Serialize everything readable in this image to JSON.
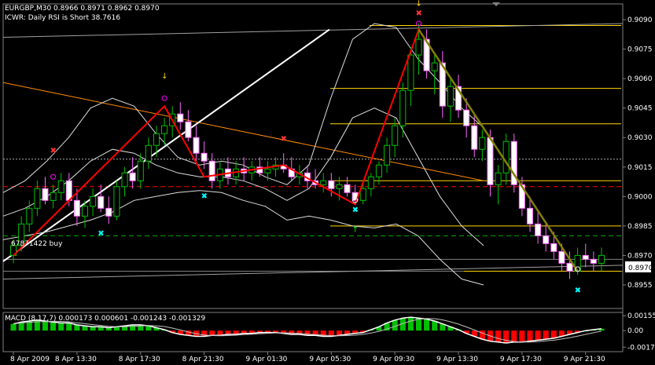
{
  "header": {
    "symbol_line": "EURGBP,M30  0.8966 0.8971 0.8962 0.8970",
    "indicator_line": "ICWR: Daily RSI is Short 38.7616"
  },
  "annotations": {
    "buy_label": "67871422 buy",
    "current_price": "0.8970"
  },
  "macd": {
    "label": "MACD (8,17,7) 0.000173 0.000601 -0.001243 -0.001329",
    "ticks": [
      "0.001556",
      "0.00",
      "-0.00173"
    ]
  },
  "chart_data": [
    {
      "type": "candlestick",
      "title": "EURGBP,M30",
      "ylim": [
        0.8943,
        0.9098
      ],
      "y_ticks": [
        "0.9090",
        "0.9075",
        "0.9060",
        "0.9045",
        "0.9030",
        "0.9015",
        "0.9000",
        "0.8985",
        "0.8970",
        "0.8955"
      ],
      "x_ticks": [
        "8 Apr 2009",
        "8 Apr 13:30",
        "8 Apr 17:30",
        "8 Apr 21:30",
        "9 Apr 01:30",
        "9 Apr 05:30",
        "9 Apr 09:30",
        "9 Apr 13:30",
        "9 Apr 17:30",
        "9 Apr 21:30"
      ],
      "candles": [
        [
          0.897,
          0.8978,
          0.8966,
          0.8975
        ],
        [
          0.8975,
          0.899,
          0.8972,
          0.8986
        ],
        [
          0.8986,
          0.8998,
          0.8982,
          0.8994
        ],
        [
          0.8994,
          0.9008,
          0.899,
          0.9004
        ],
        [
          0.9004,
          0.901,
          0.8996,
          0.8998
        ],
        [
          0.8998,
          0.9006,
          0.8994,
          0.9002
        ],
        [
          0.9002,
          0.9012,
          0.8998,
          0.9008
        ],
        [
          0.9008,
          0.9012,
          0.8995,
          0.8998
        ],
        [
          0.8998,
          0.9004,
          0.8985,
          0.899
        ],
        [
          0.899,
          0.8998,
          0.8984,
          0.8995
        ],
        [
          0.8995,
          0.9004,
          0.899,
          0.9
        ],
        [
          0.9,
          0.9006,
          0.8992,
          0.8994
        ],
        [
          0.8994,
          0.9,
          0.8986,
          0.899
        ],
        [
          0.899,
          0.9008,
          0.8988,
          0.9005
        ],
        [
          0.9005,
          0.9015,
          0.9,
          0.9012
        ],
        [
          0.9012,
          0.902,
          0.9004,
          0.9008
        ],
        [
          0.9008,
          0.9022,
          0.9004,
          0.9018
        ],
        [
          0.9018,
          0.903,
          0.9014,
          0.9026
        ],
        [
          0.9026,
          0.9036,
          0.902,
          0.9032
        ],
        [
          0.9032,
          0.904,
          0.9026,
          0.9036
        ],
        [
          0.9036,
          0.9046,
          0.903,
          0.9042
        ],
        [
          0.9042,
          0.9048,
          0.9034,
          0.9038
        ],
        [
          0.9038,
          0.9044,
          0.9028,
          0.903
        ],
        [
          0.903,
          0.9036,
          0.9018,
          0.9022
        ],
        [
          0.9022,
          0.9028,
          0.9014,
          0.9018
        ],
        [
          0.9018,
          0.9022,
          0.9004,
          0.9008
        ],
        [
          0.9008,
          0.9018,
          0.9004,
          0.9014
        ],
        [
          0.9014,
          0.902,
          0.9006,
          0.901
        ],
        [
          0.901,
          0.9018,
          0.9006,
          0.9014
        ],
        [
          0.9014,
          0.902,
          0.9008,
          0.9012
        ],
        [
          0.9012,
          0.9018,
          0.9008,
          0.9015
        ],
        [
          0.9015,
          0.902,
          0.901,
          0.9012
        ],
        [
          0.9012,
          0.9018,
          0.9008,
          0.9014
        ],
        [
          0.9014,
          0.902,
          0.901,
          0.9016
        ],
        [
          0.9016,
          0.9022,
          0.9012,
          0.9014
        ],
        [
          0.9014,
          0.902,
          0.9008,
          0.901
        ],
        [
          0.901,
          0.9016,
          0.9006,
          0.9012
        ],
        [
          0.9012,
          0.9016,
          0.9004,
          0.9008
        ],
        [
          0.9008,
          0.9014,
          0.9004,
          0.9006
        ],
        [
          0.9006,
          0.9012,
          0.9002,
          0.9008
        ],
        [
          0.9008,
          0.9012,
          0.9,
          0.9004
        ],
        [
          0.9004,
          0.901,
          0.8998,
          0.9006
        ],
        [
          0.9006,
          0.901,
          0.9,
          0.9002
        ],
        [
          0.9002,
          0.9006,
          0.8996,
          0.8998
        ],
        [
          0.8998,
          0.9006,
          0.8996,
          0.9004
        ],
        [
          0.9004,
          0.9012,
          0.9,
          0.901
        ],
        [
          0.901,
          0.9018,
          0.9006,
          0.9016
        ],
        [
          0.9016,
          0.903,
          0.9012,
          0.9026
        ],
        [
          0.9026,
          0.904,
          0.902,
          0.9036
        ],
        [
          0.9036,
          0.9058,
          0.903,
          0.9054
        ],
        [
          0.9054,
          0.9076,
          0.9046,
          0.9072
        ],
        [
          0.9072,
          0.9088,
          0.9062,
          0.908
        ],
        [
          0.908,
          0.9085,
          0.906,
          0.9064
        ],
        [
          0.9064,
          0.9072,
          0.9052,
          0.9068
        ],
        [
          0.9068,
          0.9074,
          0.904,
          0.9046
        ],
        [
          0.9046,
          0.906,
          0.9038,
          0.9056
        ],
        [
          0.9056,
          0.9062,
          0.904,
          0.9044
        ],
        [
          0.9044,
          0.905,
          0.903,
          0.9036
        ],
        [
          0.9036,
          0.9042,
          0.902,
          0.9024
        ],
        [
          0.9024,
          0.9034,
          0.9018,
          0.903
        ],
        [
          0.903,
          0.9034,
          0.9,
          0.9006
        ],
        [
          0.9006,
          0.9016,
          0.8996,
          0.9012
        ],
        [
          0.9012,
          0.9032,
          0.9006,
          0.9028
        ],
        [
          0.9028,
          0.9032,
          0.9002,
          0.9006
        ],
        [
          0.9006,
          0.901,
          0.899,
          0.8994
        ],
        [
          0.8994,
          0.9,
          0.8982,
          0.8986
        ],
        [
          0.8986,
          0.8992,
          0.8976,
          0.898
        ],
        [
          0.898,
          0.8986,
          0.8972,
          0.8976
        ],
        [
          0.8976,
          0.8982,
          0.8968,
          0.8972
        ],
        [
          0.8972,
          0.8976,
          0.8962,
          0.8966
        ],
        [
          0.8966,
          0.8972,
          0.8958,
          0.8962
        ],
        [
          0.8962,
          0.8974,
          0.896,
          0.897
        ],
        [
          0.897,
          0.8976,
          0.8964,
          0.8968
        ],
        [
          0.8968,
          0.8972,
          0.8962,
          0.8966
        ],
        [
          0.8966,
          0.8974,
          0.8962,
          0.897
        ]
      ]
    },
    {
      "type": "bar",
      "title": "MACD (8,17,7)",
      "ylim": [
        -0.0022,
        0.0019
      ],
      "values": [
        0.0007,
        0.0009,
        0.001,
        0.0011,
        0.001,
        0.0009,
        0.0008,
        0.0008,
        0.0006,
        0.0005,
        0.0004,
        0.0004,
        0.0003,
        0.0004,
        0.0005,
        0.0006,
        0.0006,
        0.0005,
        0.0003,
        0.0001,
        -0.0002,
        -0.0004,
        -0.0005,
        -0.0006,
        -0.0006,
        -0.0005,
        -0.0005,
        -0.0004,
        -0.0004,
        -0.0003,
        -0.0003,
        -0.0002,
        -0.0002,
        -0.0002,
        -0.0003,
        -0.0004,
        -0.0004,
        -0.0005,
        -0.0005,
        -0.0006,
        -0.0006,
        -0.0005,
        -0.0004,
        -0.0003,
        -0.0002,
        0.0001,
        0.0004,
        0.0008,
        0.0011,
        0.0013,
        0.0014,
        0.0013,
        0.0012,
        0.001,
        0.0007,
        0.0004,
        0.0001,
        -0.0003,
        -0.0006,
        -0.0009,
        -0.0011,
        -0.0012,
        -0.0013,
        -0.0012,
        -0.0012,
        -0.0011,
        -0.001,
        -0.0009,
        -0.0008,
        -0.0006,
        -0.0004,
        -0.0002,
        0.0,
        0.0001,
        0.0002
      ]
    }
  ]
}
